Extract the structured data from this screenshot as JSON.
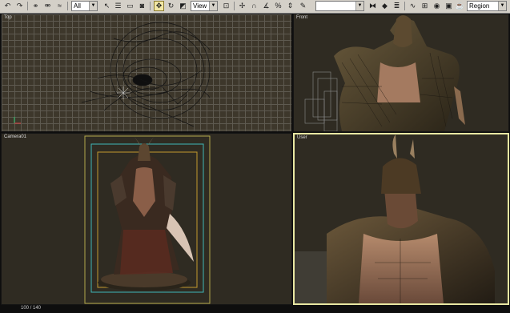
{
  "toolbar": {
    "filter_value": "All",
    "coord_system_value": "View",
    "selection_sets_value": "",
    "named_region_value": "Region",
    "icons": [
      "undo-icon",
      "redo-icon",
      "select-link-icon",
      "unlink-icon",
      "bind-space-warp-icon",
      "select-object-icon",
      "select-by-name-icon",
      "rectangular-selection-icon",
      "window-crossing-icon",
      "select-move-icon",
      "select-rotate-icon",
      "select-scale-icon",
      "use-pivot-center-icon",
      "select-manipulate-icon",
      "snaps-toggle-icon",
      "angle-snap-icon",
      "percent-snap-icon",
      "spinner-snap-icon",
      "named-selection-icon",
      "mirror-icon",
      "align-icon",
      "layer-manager-icon",
      "curve-editor-icon",
      "schematic-view-icon",
      "material-editor-icon",
      "render-setup-icon",
      "quick-render-icon"
    ]
  },
  "viewports": {
    "top": {
      "label": "Top"
    },
    "front": {
      "label": "Front"
    },
    "camera": {
      "label": "Camera01"
    },
    "user": {
      "label": "User"
    }
  },
  "status": {
    "text": "100 / 140"
  },
  "colors": {
    "toolbar_bg": "#d4d0c8",
    "viewport_bg": "#2f2b22",
    "active_border": "#e8e7a2",
    "safe_frame_outer": "#b3a94c",
    "safe_frame_cyan": "#3fb7b8",
    "safe_frame_inner": "#c39a2d"
  }
}
